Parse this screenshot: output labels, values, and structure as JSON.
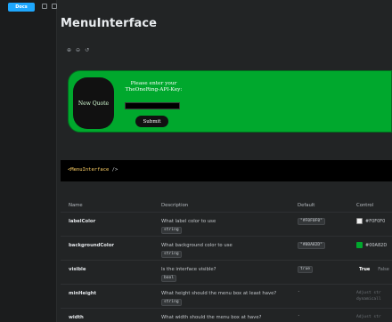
{
  "sidebar": {
    "tab_label": "Docs"
  },
  "page": {
    "title": "MenuInterface"
  },
  "zoom": {
    "zoom_in": "⊕",
    "zoom_out": "⊖",
    "reset": "↺"
  },
  "preview": {
    "quote_button": "New Quote",
    "prompt_line1": "Please enter your",
    "prompt_line2": "TheOneRing-API-Key:",
    "api_input_value": "",
    "submit_label": "Submit",
    "background_color": "#00A82D",
    "label_color": "#F0F0F0"
  },
  "code": {
    "tag": "<MenuInterface",
    "rest": " />"
  },
  "table": {
    "headers": {
      "name": "Name",
      "description": "Description",
      "default": "Default",
      "control": "Control"
    },
    "rows": [
      {
        "name": "labelColor",
        "description": "What label color to use",
        "type": "string",
        "default": "\"#F0F0F0\"",
        "control": "#F0F0F0",
        "swatch": "#F0F0F0"
      },
      {
        "name": "backgroundColor",
        "description": "What background color to use",
        "type": "string",
        "default": "\"#00A82D\"",
        "control": "#00A82D",
        "swatch": "#00A82D"
      },
      {
        "name": "visible",
        "description": "Is the interface visible?",
        "type": "bool",
        "default": "true",
        "control_true": "True",
        "control_false": "False"
      },
      {
        "name": "minHeight",
        "description": "What height should the menu box at least have?",
        "type": "string",
        "default": "-",
        "control_line1": "Adjust str",
        "control_line2": "dynamicall"
      },
      {
        "name": "width",
        "description": "What width should the menu box at have?",
        "type": "",
        "default": "-",
        "control_line1": "Adjust str",
        "control_line2": ""
      }
    ]
  }
}
